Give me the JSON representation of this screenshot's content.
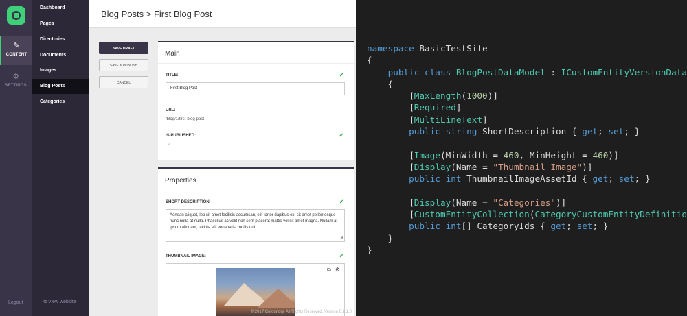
{
  "rail": {
    "items": [
      {
        "label": "CONTENT",
        "icon": "pencil-icon"
      },
      {
        "label": "SETTINGS",
        "icon": "gear-icon"
      }
    ],
    "logout": "Logout"
  },
  "nav": {
    "items": [
      {
        "label": "Dashboard"
      },
      {
        "label": "Pages"
      },
      {
        "label": "Directories"
      },
      {
        "label": "Documents"
      },
      {
        "label": "Images"
      },
      {
        "label": "Blog Posts"
      },
      {
        "label": "Categories"
      }
    ],
    "active": "Blog Posts",
    "view_website": "View website"
  },
  "page": {
    "title": "Blog Posts > First Blog Post"
  },
  "actions": {
    "save_draft": "SAVE DRAFT",
    "save_publish": "SAVE & PUBLISH",
    "cancel": "CANCEL"
  },
  "main_panel": {
    "heading": "Main",
    "title_label": "TITLE:",
    "title_value": "First Blog Post",
    "url_label": "URL:",
    "url_value": "/blog/1/first-blog-post",
    "published_label": "IS PUBLISHED:",
    "published_checked": true
  },
  "properties_panel": {
    "heading": "Properties",
    "short_desc_label": "SHORT DESCRIPTION:",
    "short_desc_value": "Aenean aliquet, leo sit amet facilisis accumsan, elit tortor dapibus ex, sit amet pellentesque nunc nulla at nulla. Phasellus ac velit non sem placerat mattis vel sit amet magna. Nullam at ipsum aliquam, lacinia elit venenatis, mollis dui.",
    "thumbnail_label": "THUMBNAIL IMAGE:"
  },
  "footer": "© 2017 Cofoundry. All Rights Reserved. Version 0.1.1.0",
  "colors": {
    "accent": "#3fd07a",
    "sidebar": "#3a3448",
    "nav": "#2c2838",
    "check": "#3fb05a",
    "editor_bg": "#1e1e1e"
  },
  "code": {
    "language": "csharp",
    "lines": [
      "namespace BasicTestSite",
      "{",
      "    public class BlogPostDataModel : ICustomEntityVersionDataMo",
      "    {",
      "        [MaxLength(1000)]",
      "        [Required]",
      "        [MultiLineText]",
      "        public string ShortDescription { get; set; }",
      "",
      "        [Image(MinWidth = 460, MinHeight = 460)]",
      "        [Display(Name = \"Thumbnail Image\")]",
      "        public int ThumbnailImageAssetId { get; set; }",
      "",
      "        [Display(Name = \"Categories\")]",
      "        [CustomEntityCollection(CategoryCustomEntityDefinition",
      "        public int[] CategoryIds { get; set; }",
      "    }",
      "}"
    ]
  }
}
